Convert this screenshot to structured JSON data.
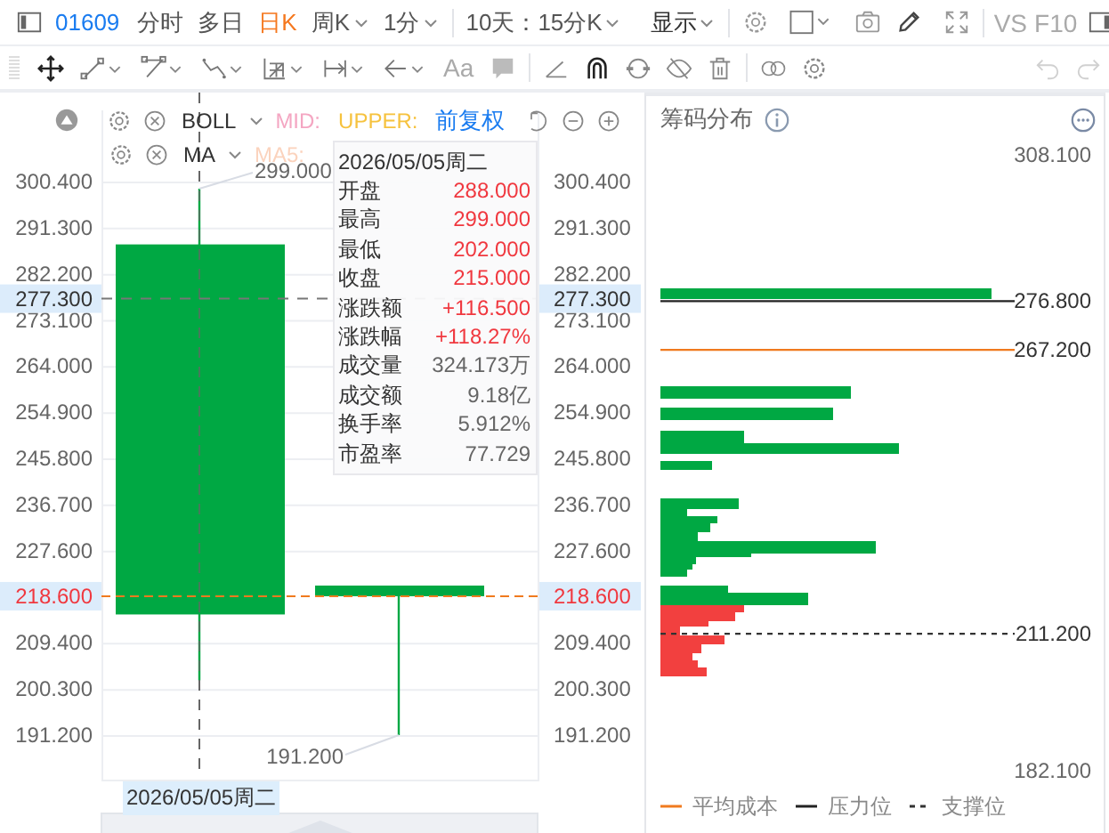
{
  "top_bar": {
    "code": "01609",
    "tabs": [
      {
        "label": "分时",
        "selected": false,
        "dropdown": false
      },
      {
        "label": "多日",
        "selected": false,
        "dropdown": false
      },
      {
        "label": "日K",
        "selected": true,
        "dropdown": false
      },
      {
        "label": "周K",
        "selected": false,
        "dropdown": true
      },
      {
        "label": "1分",
        "selected": false,
        "dropdown": true
      }
    ],
    "range": "10天：15分K",
    "display": "显示",
    "vs": "VS",
    "f10": "F10"
  },
  "drawing_toolbar": {
    "text_tool": "Aa",
    "undo_disabled": true,
    "redo_disabled": true
  },
  "indicators": [
    {
      "name": "BOLL",
      "params": [
        {
          "label": "MID:",
          "color": "#f4a6c2"
        },
        {
          "label": "UPPER:",
          "color": "#f6c23e"
        }
      ],
      "adjust": "前复权"
    },
    {
      "name": "MA",
      "params": [
        {
          "label": "MA5:",
          "color": "#fbd3bd"
        }
      ]
    }
  ],
  "chart": {
    "ticks": [
      "300.400",
      "291.300",
      "282.200",
      "273.100",
      "264.000",
      "254.900",
      "245.800",
      "236.700",
      "227.600",
      "209.400",
      "200.300",
      "191.200"
    ],
    "right_ticks": [
      "300.400",
      "291.300",
      "282.200",
      "273.100",
      "264.000",
      "254.900",
      "245.800",
      "236.700",
      "227.600",
      "209.400",
      "200.300",
      "191.200"
    ],
    "crosshair_price": "277.300",
    "right_crosshair_price": "277.300",
    "last_price": "218.600",
    "right_last_price": "218.600",
    "candles": [
      {
        "high_label": "299.000"
      },
      {
        "low_label": "191.200"
      }
    ],
    "crosshair_date": "2026/05/05周二"
  },
  "tooltip": {
    "date": "2026/05/05周二",
    "rows": [
      {
        "label": "开盘",
        "value": "288.000",
        "color": "#f0383f"
      },
      {
        "label": "最高",
        "value": "299.000",
        "color": "#f0383f"
      },
      {
        "label": "最低",
        "value": "202.000",
        "color": "#f0383f"
      },
      {
        "label": "收盘",
        "value": "215.000",
        "color": "#f0383f"
      },
      {
        "label": "涨跌额",
        "value": "+116.500",
        "color": "#f0383f"
      },
      {
        "label": "涨跌幅",
        "value": "+118.27%",
        "color": "#f0383f"
      },
      {
        "label": "成交量",
        "value": "324.173万",
        "color": "#666666"
      },
      {
        "label": "成交额",
        "value": "9.18亿",
        "color": "#666666"
      },
      {
        "label": "换手率",
        "value": "5.912%",
        "color": "#666666"
      },
      {
        "label": "市盈率",
        "value": "77.729",
        "color": "#666666"
      }
    ]
  },
  "chip_panel": {
    "title": "筹码分布",
    "top_label": "308.100",
    "bottom_label": "182.100",
    "lines": [
      {
        "kind": "pressure",
        "label": "276.800"
      },
      {
        "kind": "avg_cost",
        "label": "267.200"
      },
      {
        "kind": "support",
        "label": "211.200"
      }
    ],
    "legend": [
      {
        "kind": "avg_cost",
        "label": "平均成本"
      },
      {
        "kind": "pressure",
        "label": "压力位"
      },
      {
        "kind": "support",
        "label": "支撑位"
      }
    ]
  }
}
